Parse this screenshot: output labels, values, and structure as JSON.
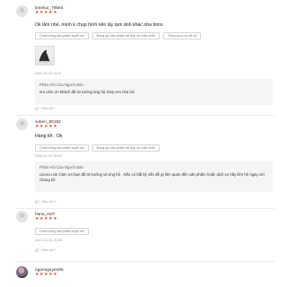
{
  "reviews": [
    {
      "username": "timeluu_79564",
      "stars": "★★★★★",
      "text": "Ok lắm nhé, mình k chụp hình nên lấy tạm ảnh khác nha bnns",
      "tags": [
        "Chất lượng sản phẩm tuyệt vời",
        "Đóng gói sản phẩm rất đẹp và chắc chắn",
        "Shop phục vụ rất tốt"
      ],
      "timestamp": "2021-01-22 11:37",
      "reply": {
        "title": "Phản Hồi Của Người Bán",
        "lines": [
          "em cảm ơn khách đã tin tưởng ủng hộ shop em nha hiii"
        ]
      },
      "helpful": "Hữu ích?"
    },
    {
      "username": "vutien_80182",
      "stars": "★★★★★",
      "text": "Hàng tốt . Ok",
      "tags": [
        "Chất lượng sản phẩm tuyệt vời",
        "Đóng gói sản phẩm rất đẹp và chắc chắn"
      ],
      "timestamp": "2020-11-12 19:56",
      "reply": {
        "title": "Phản Hồi Của Người Bán",
        "lines": [
          "cococu xin Cảm ơn bạn đã tin tưởng và ủng hộ . Nếu có bất kỳ vấn đề gì liên quan đến sản phẩm hoặc dịch vụ hãy liên hệ ngay với",
          "chúng tôi"
        ]
      },
      "helpful": "Hữu ích?"
    },
    {
      "username": "hana_m07",
      "stars": "★★★★★",
      "tags": [
        "Chất lượng sản phẩm tuyệt vời"
      ],
      "timestamp": "2021-03-31 21:06",
      "helpful": "Hữu ích?"
    },
    {
      "username": "ngannguyen95",
      "stars": "★★★★★"
    }
  ]
}
